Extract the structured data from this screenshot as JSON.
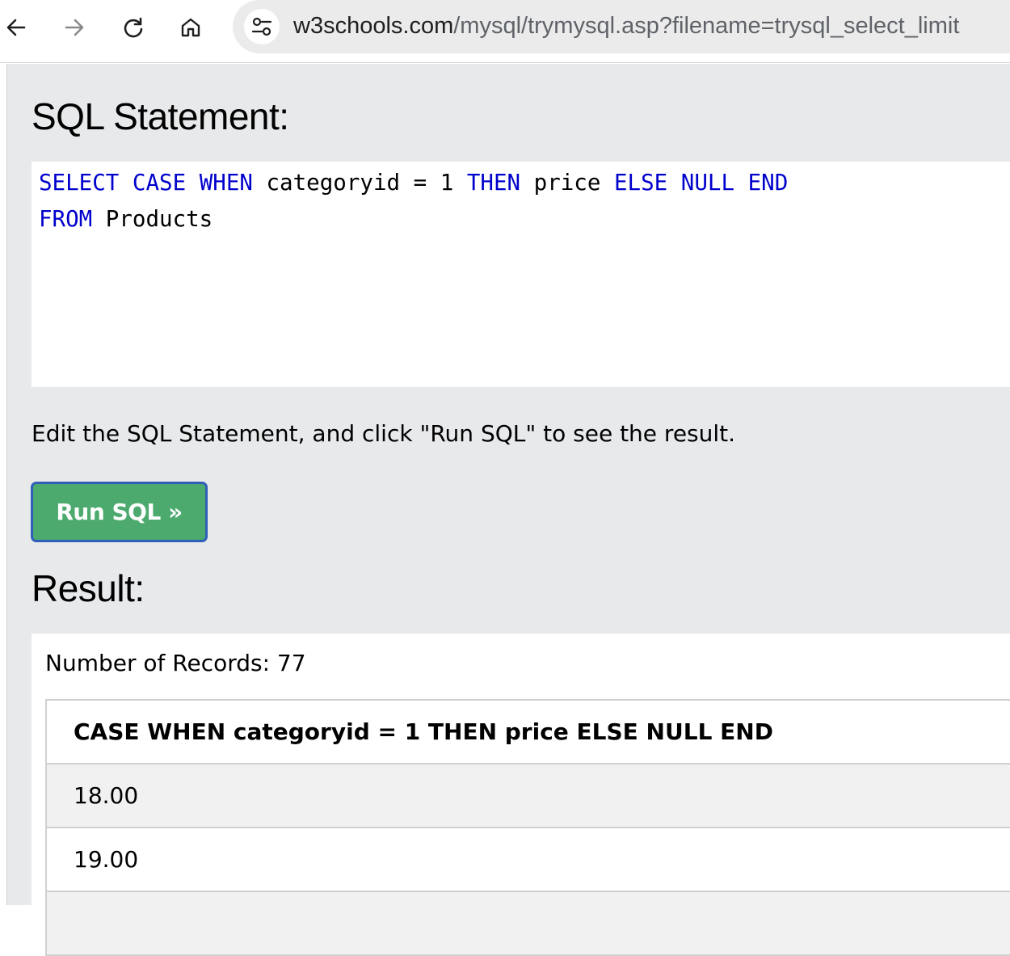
{
  "browser": {
    "back_icon": "arrow-left-icon",
    "forward_icon": "arrow-right-icon",
    "reload_icon": "reload-icon",
    "home_icon": "home-icon",
    "site_info_icon": "tune-icon",
    "url_domain": "w3schools.com",
    "url_path": "/mysql/trymysql.asp?filename=trysql_select_limit"
  },
  "page": {
    "statement_heading": "SQL Statement:",
    "code": {
      "line1": [
        {
          "text": "SELECT",
          "kw": true
        },
        {
          "text": " ",
          "kw": false
        },
        {
          "text": "CASE",
          "kw": true
        },
        {
          "text": " ",
          "kw": false
        },
        {
          "text": "WHEN",
          "kw": true
        },
        {
          "text": " categoryid = 1 ",
          "kw": false
        },
        {
          "text": "THEN",
          "kw": true
        },
        {
          "text": " price ",
          "kw": false
        },
        {
          "text": "ELSE",
          "kw": true
        },
        {
          "text": " ",
          "kw": false
        },
        {
          "text": "NULL",
          "kw": true
        },
        {
          "text": " ",
          "kw": false
        },
        {
          "text": "END",
          "kw": true
        }
      ],
      "line2": [
        {
          "text": "FROM",
          "kw": true
        },
        {
          "text": " Products",
          "kw": false
        }
      ]
    },
    "instruction": "Edit the SQL Statement, and click \"Run SQL\" to see the result.",
    "run_button": "Run SQL »",
    "result_heading": "Result:",
    "records_label": "Number of Records: 77",
    "table": {
      "header": "CASE WHEN categoryid = 1 THEN price ELSE NULL END",
      "rows": [
        "18.00",
        "19.00",
        ""
      ]
    }
  },
  "colors": {
    "keyword": "#0000cc",
    "button": "#4caa6e",
    "button_border": "#2f5fb8",
    "page_bg": "#e7e9eb"
  }
}
